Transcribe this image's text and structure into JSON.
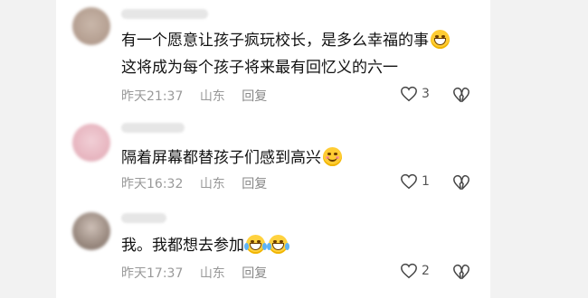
{
  "comments": [
    {
      "lines": [
        "有一个愿意让孩子疯玩校长，是多么幸福的事",
        "这将成为每个孩子将来最有回忆义的六一"
      ],
      "emoji": "grin-icon",
      "time": "昨天21:37",
      "location": "山东",
      "reply_label": "回复",
      "likes": "3"
    },
    {
      "lines": [
        "隔着屏幕都替孩子们感到高兴"
      ],
      "emoji": "smile-icon",
      "time": "昨天16:32",
      "location": "山东",
      "reply_label": "回复",
      "likes": "1"
    },
    {
      "lines": [
        "我。我都想去参加"
      ],
      "emoji": "laugh-cry-icon",
      "time": "昨天17:37",
      "location": "山东",
      "reply_label": "回复",
      "likes": "2"
    }
  ],
  "colors": {
    "text": "#111111",
    "meta": "#999999",
    "background": "#f2f2f2",
    "card": "#ffffff"
  }
}
